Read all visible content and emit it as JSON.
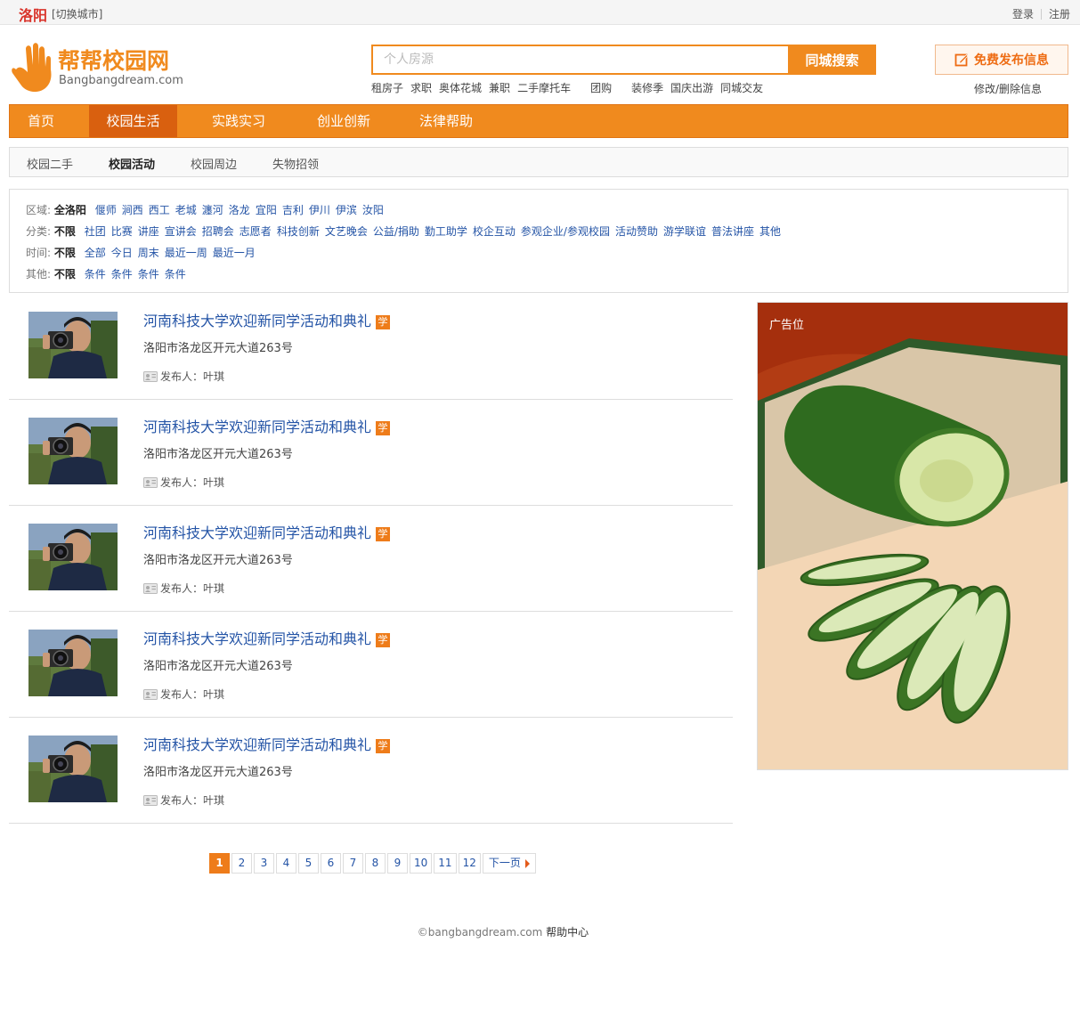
{
  "topbar": {
    "city": "洛阳",
    "switch_city": "[切换城市]",
    "login": "登录",
    "register": "注册"
  },
  "header": {
    "logo_cn": "帮帮校园网",
    "logo_en": "Bangbangdream.com",
    "search_placeholder": "个人房源",
    "search_button": "同城搜索",
    "hotwords": [
      "租房子",
      "求职",
      "奥体花城",
      "兼职",
      "二手摩托车",
      "团购",
      "装修季",
      "国庆出游",
      "同城交友"
    ],
    "publish_button": "免费发布信息",
    "modify_link": "修改/删除信息"
  },
  "mainnav": {
    "items": [
      "首页",
      "校园生活",
      "实践实习",
      "创业创新",
      "法律帮助"
    ],
    "active": "校园生活"
  },
  "subnav": {
    "items": [
      "校园二手",
      "校园活动",
      "校园周边",
      "失物招领"
    ],
    "active": "校园活动"
  },
  "filter": {
    "region": {
      "label": "区域:",
      "selected": "全洛阳",
      "options": [
        "偃师",
        "涧西",
        "西工",
        "老城",
        "瀍河",
        "洛龙",
        "宜阳",
        "吉利",
        "伊川",
        "伊滨",
        "汝阳"
      ]
    },
    "category": {
      "label": "分类:",
      "selected": "不限",
      "options": [
        "社团",
        "比赛",
        "讲座",
        "宣讲会",
        "招聘会",
        "志愿者",
        "科技创新",
        "文艺晚会",
        "公益/捐助",
        "勤工助学",
        "校企互动",
        "参观企业/参观校园",
        "活动赞助",
        "游学联谊",
        "普法讲座",
        "其他"
      ]
    },
    "time": {
      "label": "时间:",
      "selected": "不限",
      "options": [
        "全部",
        "今日",
        "周末",
        "最近一周",
        "最近一月"
      ]
    },
    "other": {
      "label": "其他:",
      "selected": "不限",
      "options": [
        "条件",
        "条件",
        "条件",
        "条件"
      ]
    }
  },
  "listings": [
    {
      "title": "河南科技大学欢迎新同学活动和典礼",
      "badge": "学",
      "address": "洛阳市洛龙区开元大道263号",
      "publisher": "发布人：叶琪"
    },
    {
      "title": "河南科技大学欢迎新同学活动和典礼",
      "badge": "学",
      "address": "洛阳市洛龙区开元大道263号",
      "publisher": "发布人：叶琪"
    },
    {
      "title": "河南科技大学欢迎新同学活动和典礼",
      "badge": "学",
      "address": "洛阳市洛龙区开元大道263号",
      "publisher": "发布人：叶琪"
    },
    {
      "title": "河南科技大学欢迎新同学活动和典礼",
      "badge": "学",
      "address": "洛阳市洛龙区开元大道263号",
      "publisher": "发布人：叶琪"
    },
    {
      "title": "河南科技大学欢迎新同学活动和典礼",
      "badge": "学",
      "address": "洛阳市洛龙区开元大道263号",
      "publisher": "发布人：叶琪"
    }
  ],
  "ad": {
    "label": "广告位"
  },
  "pagination": {
    "pages": [
      "1",
      "2",
      "3",
      "4",
      "5",
      "6",
      "7",
      "8",
      "9",
      "10",
      "11",
      "12"
    ],
    "current": "1",
    "next": "下一页"
  },
  "footer": {
    "copyright": "©bangbangdream.com",
    "help": "帮助中心"
  },
  "colors": {
    "brand_orange": "#f08a1e",
    "nav_active": "#d9600f",
    "link_blue": "#2454a6",
    "city_red": "#d9342b"
  }
}
